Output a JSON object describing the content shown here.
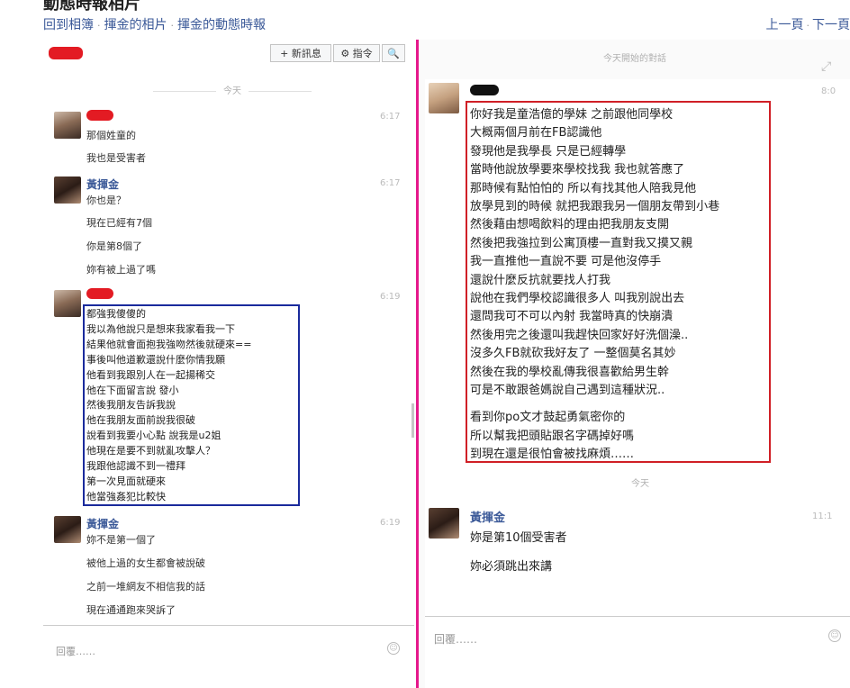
{
  "header": {
    "title": "動態時報相片",
    "crumbs": [
      "回到相簿",
      "揮金的相片",
      "揮金的動態時報"
    ],
    "prev": "上一頁",
    "next": "下一頁"
  },
  "left": {
    "toolbar": {
      "new_message": "+ 新訊息",
      "actions": "⚙ 指令",
      "search_icon": "🔍"
    },
    "today_label": "今天",
    "msg1": {
      "time": "6:17",
      "lines": [
        "那個姓童的",
        "我也是受害者"
      ]
    },
    "msg2": {
      "sender": "黃揮金",
      "time": "6:17",
      "lines": [
        "你也是？",
        "現在已經有7個",
        "你是第8個了",
        "妳有被上過了嗎"
      ]
    },
    "msg3": {
      "time": "6:19",
      "lines": [
        "都強我傻傻的",
        "我以為他說只是想來我家看我一下",
        "結果他就會面抱我強吻然後就硬來==",
        "事後叫他道歉還說什麼你情我願",
        "他看到我跟別人在一起揚稀交",
        "他在下面留言說 發小",
        "然後我朋友告訴我說",
        "他在我朋友面前說我很破",
        "說看到我要小心點 說我是u2姐",
        "他現在是要不到就亂攻擊人？",
        "我跟他認識不到一禮拜",
        "第一次見面就硬來",
        "他當強姦犯比較快"
      ]
    },
    "msg4": {
      "sender": "黃揮金",
      "time": "6:19",
      "lines": [
        "妳不是第一個了",
        "被他上過的女生都會被說破",
        "之前一堆網友不相信我的話",
        "現在通通跑來哭訴了"
      ]
    },
    "compose_placeholder": "回覆……",
    "smile_icon": "☺"
  },
  "right": {
    "header_label": "今天開始的對話",
    "msg1_time": "8:0",
    "box_lines": [
      "你好我是童浩億的學妹 之前跟他同學校",
      "大概兩個月前在FB認識他",
      "發現他是我學長 只是已經轉學",
      "當時他說放學要來學校找我 我也就答應了",
      "那時候有點怕怕的 所以有找其他人陪我見他",
      "放學見到的時候 就把我跟我另一個朋友帶到小巷",
      "然後藉由想喝飲料的理由把我朋友支開",
      "然後把我強拉到公寓頂樓一直對我又摸又親",
      "我一直推他一直說不要 可是他沒停手",
      "還說什麼反抗就要找人打我",
      "說他在我們學校認識很多人 叫我別說出去",
      "還問我可不可以內射 我當時真的快崩潰",
      "然後用完之後還叫我趕快回家好好洗個澡..",
      "沒多久FB就砍我好友了 一整個莫名其妙",
      "然後在我的學校亂傳我很喜歡給男生幹",
      "可是不敢跟爸媽說自己遇到這種狀況..",
      "看到你po文才鼓起勇氣密你的",
      "所以幫我把頭貼跟名字碼掉好嗎",
      "到現在還是很怕會被找麻煩……"
    ],
    "today_label": "今天",
    "msg2": {
      "sender": "黃揮金",
      "time": "11:1",
      "lines": [
        "妳是第10個受害者",
        "妳必須跳出來講"
      ]
    },
    "compose_placeholder": "回覆……",
    "expand_icon": "⤢",
    "smile_icon": "☺"
  }
}
